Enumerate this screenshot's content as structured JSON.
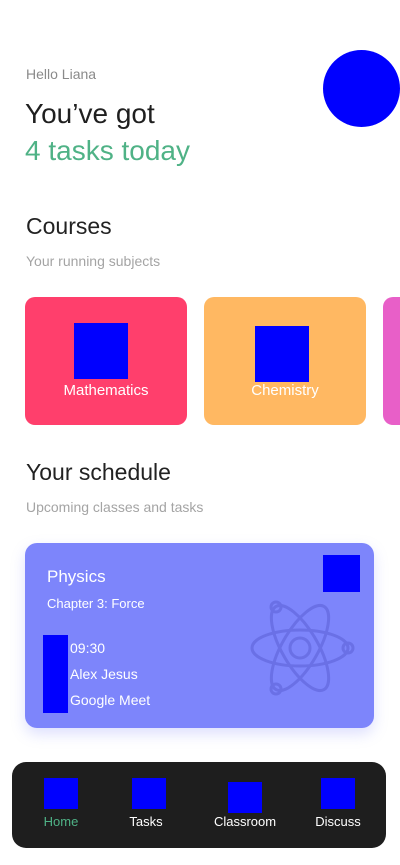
{
  "header": {
    "greeting": "Hello Liana",
    "headline": "You’ve got",
    "headline_accent": "4 tasks today",
    "avatar_color": "#0000ff"
  },
  "courses": {
    "title": "Courses",
    "subtitle": "Your running subjects",
    "items": [
      {
        "label": "Mathematics",
        "color": "#ff3f6c"
      },
      {
        "label": "Chemistry",
        "color": "#ffb862"
      },
      {
        "label": "",
        "color": "#e85fc8"
      }
    ]
  },
  "schedule": {
    "title": "Your schedule",
    "subtitle": "Upcoming classes and tasks",
    "card": {
      "subject": "Physics",
      "chapter": "Chapter 3: Force",
      "time": "09:30",
      "teacher": "Alex Jesus",
      "platform": "Google Meet",
      "color": "#7d85fb"
    }
  },
  "nav": {
    "items": [
      {
        "label": "Home",
        "icon": "home-icon",
        "active": true
      },
      {
        "label": "Tasks",
        "icon": "tasks-icon",
        "active": false
      },
      {
        "label": "Classroom",
        "icon": "classroom-icon",
        "active": false
      },
      {
        "label": "Discuss",
        "icon": "discuss-icon",
        "active": false
      }
    ],
    "active_color": "#4fb286"
  }
}
